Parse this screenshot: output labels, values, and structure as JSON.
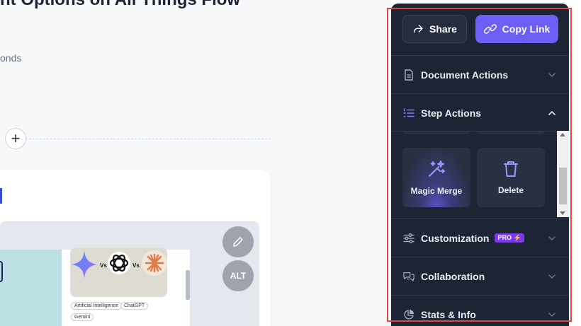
{
  "document": {
    "title": "nt Options on All Things Flow",
    "subtitle": "onds",
    "image": {
      "tags": [
        "Artificial Intelligence",
        "ChatGPT",
        "Gemini"
      ]
    },
    "edit_icon": "pencil-icon",
    "alt_label": "ALT"
  },
  "panel": {
    "share_label": "Share",
    "copy_link_label": "Copy Link",
    "sections": {
      "document_actions": "Document Actions",
      "step_actions": "Step Actions",
      "customization": "Customization",
      "collaboration": "Collaboration",
      "stats_info": "Stats & Info"
    },
    "pro_badge": "PRO",
    "step_tiles": {
      "magic_merge": "Magic Merge",
      "delete": "Delete"
    }
  },
  "colors": {
    "panel_bg": "#1d2433",
    "accent": "#6d5ff6",
    "pro_badge": "#7c3aed",
    "highlight_border": "#e0483f"
  }
}
